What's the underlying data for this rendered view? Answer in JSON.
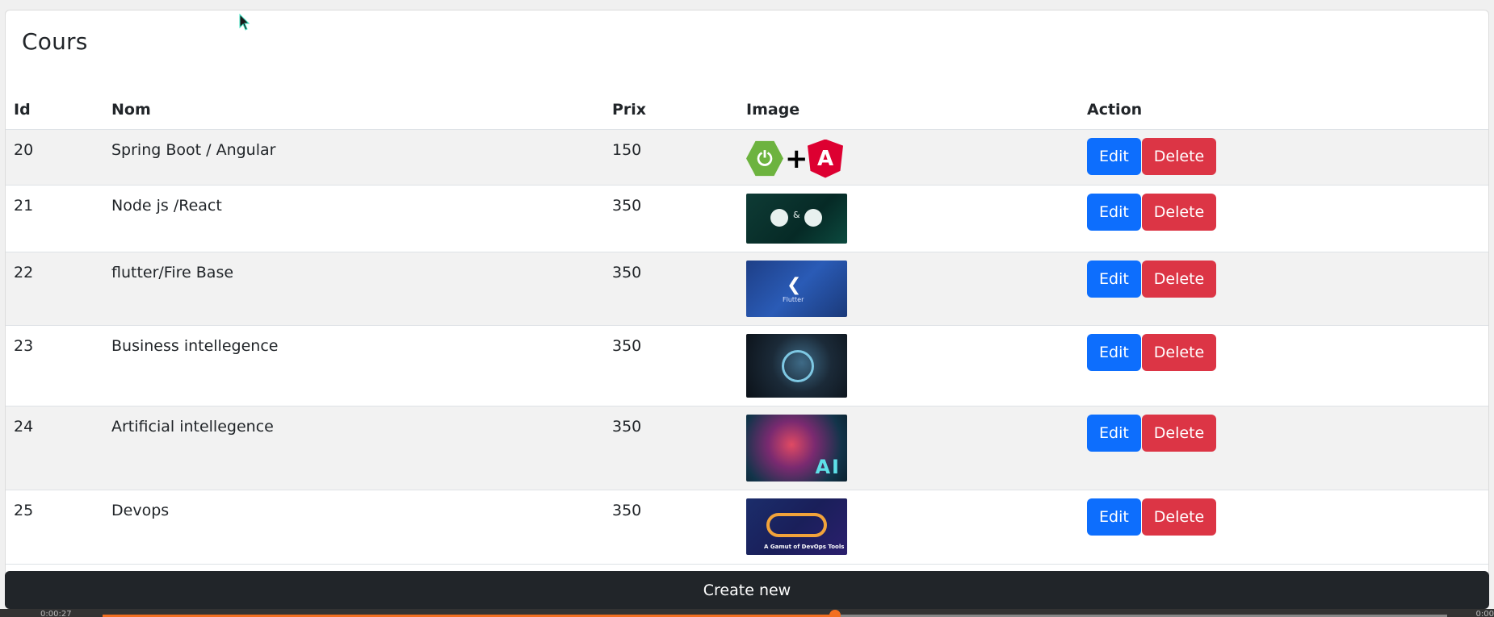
{
  "title": "Cours",
  "table": {
    "headers": [
      "Id",
      "Nom",
      "Prix",
      "Image",
      "Action"
    ],
    "rows": [
      {
        "id": "20",
        "nom": "Spring Boot / Angular",
        "prix": "150",
        "image": "spring-angular-logo"
      },
      {
        "id": "21",
        "nom": "Node js /React",
        "prix": "350",
        "image": "node-react-thumbnail"
      },
      {
        "id": "22",
        "nom": "flutter/Fire Base",
        "prix": "350",
        "image": "flutter-thumbnail"
      },
      {
        "id": "23",
        "nom": "Business intellegence",
        "prix": "350",
        "image": "business-intelligence-thumbnail"
      },
      {
        "id": "24",
        "nom": "Artificial intellegence",
        "prix": "350",
        "image": "ai-brain-thumbnail"
      },
      {
        "id": "25",
        "nom": "Devops",
        "prix": "350",
        "image": "devops-thumbnail"
      }
    ],
    "edit_label": "Edit",
    "delete_label": "Delete"
  },
  "thumbnail_text": {
    "flutter": "Flutter",
    "ai": "AI",
    "devops": "A Gamut of DevOps Tools"
  },
  "create_label": "Create new",
  "video": {
    "time_left": "0:00:27",
    "time_right": "0:00",
    "progress": 0.545
  },
  "colors": {
    "edit": "#0d6efd",
    "delete": "#dc3545",
    "create_bar": "#212529",
    "video_progress": "#f36f21"
  }
}
